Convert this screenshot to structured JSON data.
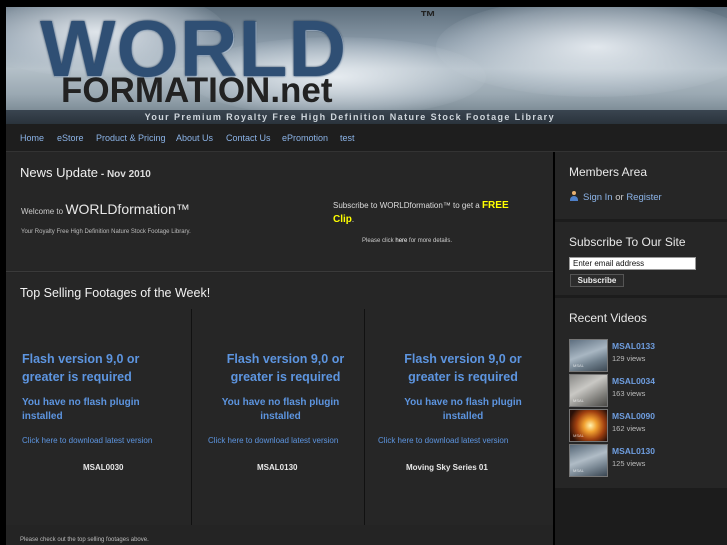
{
  "header": {
    "logo_top": "WORLD",
    "logo_tm": "™",
    "logo_bottom": "FORMATION.net",
    "tagline": "Your Premium Royalty Free High Definition Nature Stock Footage Library"
  },
  "nav": {
    "items": [
      "Home",
      "eStore",
      "Product & Pricing",
      "About Us",
      "Contact Us",
      "ePromotion",
      "test"
    ]
  },
  "news": {
    "title": "News Update",
    "dash": " - ",
    "date": "Nov 2010",
    "welcome_prefix": "Welcome to ",
    "welcome_brand": "WORLDformation™",
    "welcome_sub": "Your Royalty Free High Definition Nature Stock Footage Library.",
    "subscribe_prefix": "Subscribe to WORLDformation™ to get a ",
    "subscribe_free": "FREE",
    "subscribe_clip": "Clip",
    "subscribe_end": ".",
    "details_prefix": "Please click ",
    "details_link": "here",
    "details_suffix": " for more details."
  },
  "top_selling": {
    "title": "Top Selling Footages of the Week!",
    "columns": [
      {
        "heading": "Flash version 9,0 or greater is required",
        "sub": "You have no flash plugin installed",
        "link": "Click here to download latest version",
        "name": "MSAL0030"
      },
      {
        "heading": "Flash version 9,0 or greater is required",
        "sub": "You have no flash plugin installed",
        "link": "Click here to download latest version",
        "name": "MSAL0130"
      },
      {
        "heading": "Flash version 9,0 or greater is required",
        "sub": "You have no flash plugin installed",
        "link": "Click here to download latest version",
        "name": "Moving Sky Series 01"
      }
    ],
    "footer_note": "Please check out the top selling footages above."
  },
  "sidebar": {
    "members": {
      "title": "Members Area",
      "signin": "Sign In",
      "or": " or ",
      "register": "Register"
    },
    "subscribe": {
      "title": "Subscribe To Our Site",
      "email_value": "Enter email address",
      "button": "Subscribe"
    },
    "recent": {
      "title": "Recent Videos",
      "videos": [
        {
          "title": "MSAL0133",
          "views": "129 views",
          "thumb_tag": "MSAL"
        },
        {
          "title": "MSAL0034",
          "views": "163 views",
          "thumb_tag": "MSAL"
        },
        {
          "title": "MSAL0090",
          "views": "162 views",
          "thumb_tag": "MSAL"
        },
        {
          "title": "MSAL0130",
          "views": "125 views",
          "thumb_tag": "MSAL"
        }
      ]
    }
  },
  "colors": {
    "link_blue": "#5d95e0",
    "nav_blue": "#8cb4e8",
    "free_yellow": "#ffff00",
    "panel_bg": "#262626"
  }
}
